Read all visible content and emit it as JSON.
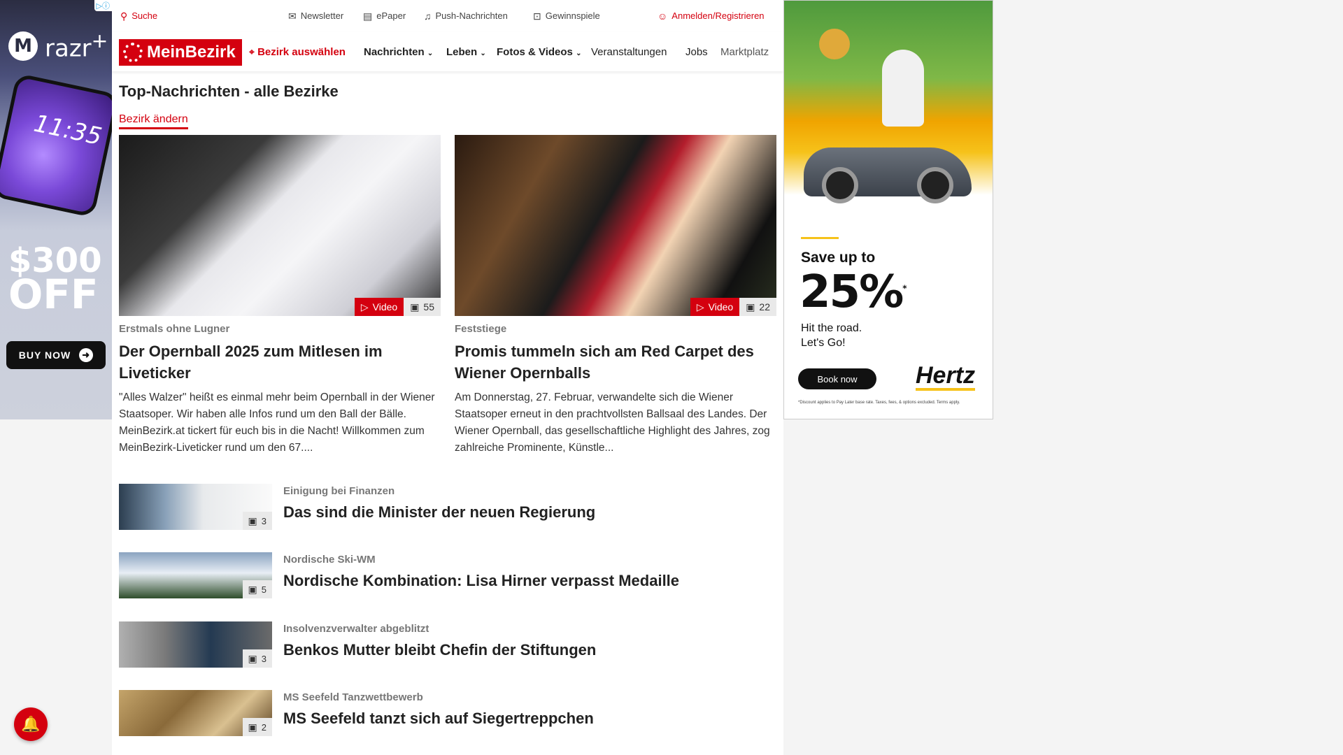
{
  "ad_left": {
    "brand": "razr",
    "brand_sup": "+",
    "clock": "11:35",
    "amount": "$300",
    "off": "OFF",
    "cta": "BUY NOW",
    "adchoice": "▷ⓘ"
  },
  "ad_right": {
    "save_up": "Save up to",
    "percent": "25%",
    "star": "*",
    "line1": "Hit the road.",
    "line2": "Let's Go!",
    "cta": "Book now",
    "brand": "Hertz",
    "fine": "*Discount applies to Pay Later base rate. Taxes, fees, & options excluded. Terms apply.",
    "adchoice": "▷ⓘ"
  },
  "topbar": {
    "search": "Suche",
    "newsletter": "Newsletter",
    "epaper": "ePaper",
    "push": "Push-Nachrichten",
    "gewinnspiele": "Gewinnspiele",
    "login": "Anmelden/Registrieren"
  },
  "nav": {
    "logo": "MeinBezirk",
    "bezirk": "Bezirk auswählen",
    "items": [
      "Nachrichten",
      "Leben",
      "Fotos & Videos",
      "Veranstaltungen",
      "Jobs",
      "Marktplatz"
    ]
  },
  "section": {
    "title": "Top-Nachrichten - alle Bezirke",
    "change": "Bezirk ändern"
  },
  "cards": [
    {
      "video_label": "Video",
      "count": "55",
      "kicker": "Erstmals ohne Lugner",
      "headline": "Der Opernball 2025 zum Mitlesen im Liveticker",
      "teaser": "\"Alles Walzer\" heißt es einmal mehr beim Opernball in der Wiener Staatsoper. Wir haben alle Infos rund um den Ball der Bälle. MeinBezirk.at tickert für euch bis in die Nacht! Willkommen zum MeinBezirk-Liveticker rund um den 67...."
    },
    {
      "video_label": "Video",
      "count": "22",
      "kicker": "Feststiege",
      "headline": "Promis tummeln sich am Red Carpet des Wiener Opernballs",
      "teaser": "Am Donnerstag, 27. Februar, verwandelte sich die Wiener Staatsoper erneut in den prachtvollsten Ballsaal des Landes. Der Wiener Opernball, das gesellschaftliche Highlight des Jahres, zog zahlreiche Prominente, Künstle..."
    }
  ],
  "list": [
    {
      "count": "3",
      "kicker": "Einigung bei Finanzen",
      "headline": "Das sind die Minister der neuen Regierung"
    },
    {
      "count": "5",
      "kicker": "Nordische Ski-WM",
      "headline": "Nordische Kombination: Lisa Hirner verpasst Medaille"
    },
    {
      "count": "3",
      "kicker": "Insolvenzverwalter abgeblitzt",
      "headline": "Benkos Mutter bleibt Chefin der Stiftungen"
    },
    {
      "count": "2",
      "kicker": "MS Seefeld Tanzwettbewerb",
      "headline": "MS Seefeld tanzt sich auf Siegertreppchen"
    }
  ]
}
